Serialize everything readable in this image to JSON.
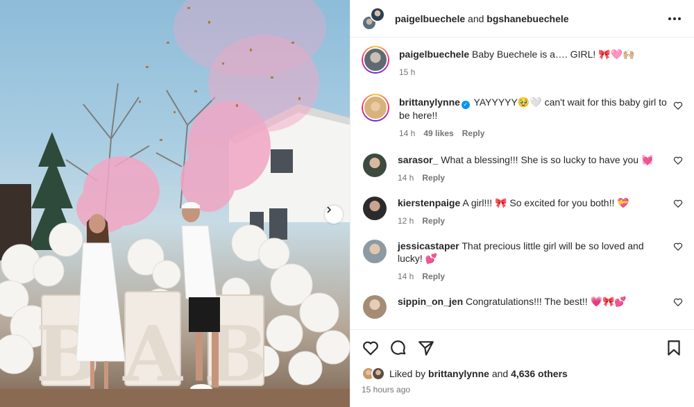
{
  "post": {
    "authors": {
      "primary": "paigelbuechele",
      "joiner": "and",
      "secondary": "bgshanebuechele"
    }
  },
  "caption": {
    "user": "paigelbuechele",
    "text": "Baby Buechele is a…. GIRL! 🎀🩷🙌🏼",
    "time": "15 h"
  },
  "comments": [
    {
      "user": "brittanylynne",
      "verified": true,
      "text": "YAYYYYY🥹🤍 can't wait for this baby girl to be here!!",
      "time": "14 h",
      "likes": "49 likes",
      "reply": "Reply"
    },
    {
      "user": "sarasor_",
      "verified": false,
      "text": "What a blessing!!! She is so lucky to have you 💓",
      "time": "14 h",
      "likes": "",
      "reply": "Reply"
    },
    {
      "user": "kierstenpaige",
      "verified": false,
      "text": "A girl!!! 🎀 So excited for you both!! 💝",
      "time": "12 h",
      "likes": "",
      "reply": "Reply"
    },
    {
      "user": "jessicastaper",
      "verified": false,
      "text": "That precious little girl will be so loved and lucky! 💕",
      "time": "14 h",
      "likes": "",
      "reply": "Reply"
    },
    {
      "user": "sippin_on_jen",
      "verified": false,
      "text": "Congratulations!!! The best!! 💗🎀💕",
      "time": "",
      "likes": "",
      "reply": ""
    }
  ],
  "likes": {
    "prefix": "Liked by",
    "user": "brittanylynne",
    "joiner": "and",
    "others": "4,636 others"
  },
  "posted_ago": "15 hours ago",
  "photo": {
    "letters": [
      "B",
      "A",
      "B"
    ]
  },
  "icons": {
    "more": "more-horizontal-icon",
    "like": "heart-icon",
    "comment": "comment-icon",
    "share": "paper-plane-icon",
    "save": "bookmark-icon",
    "next": "chevron-right-icon"
  },
  "colors": {
    "smoke_pink": "#f2a6c4",
    "verified": "#0095f6",
    "meta_text": "#737373"
  }
}
